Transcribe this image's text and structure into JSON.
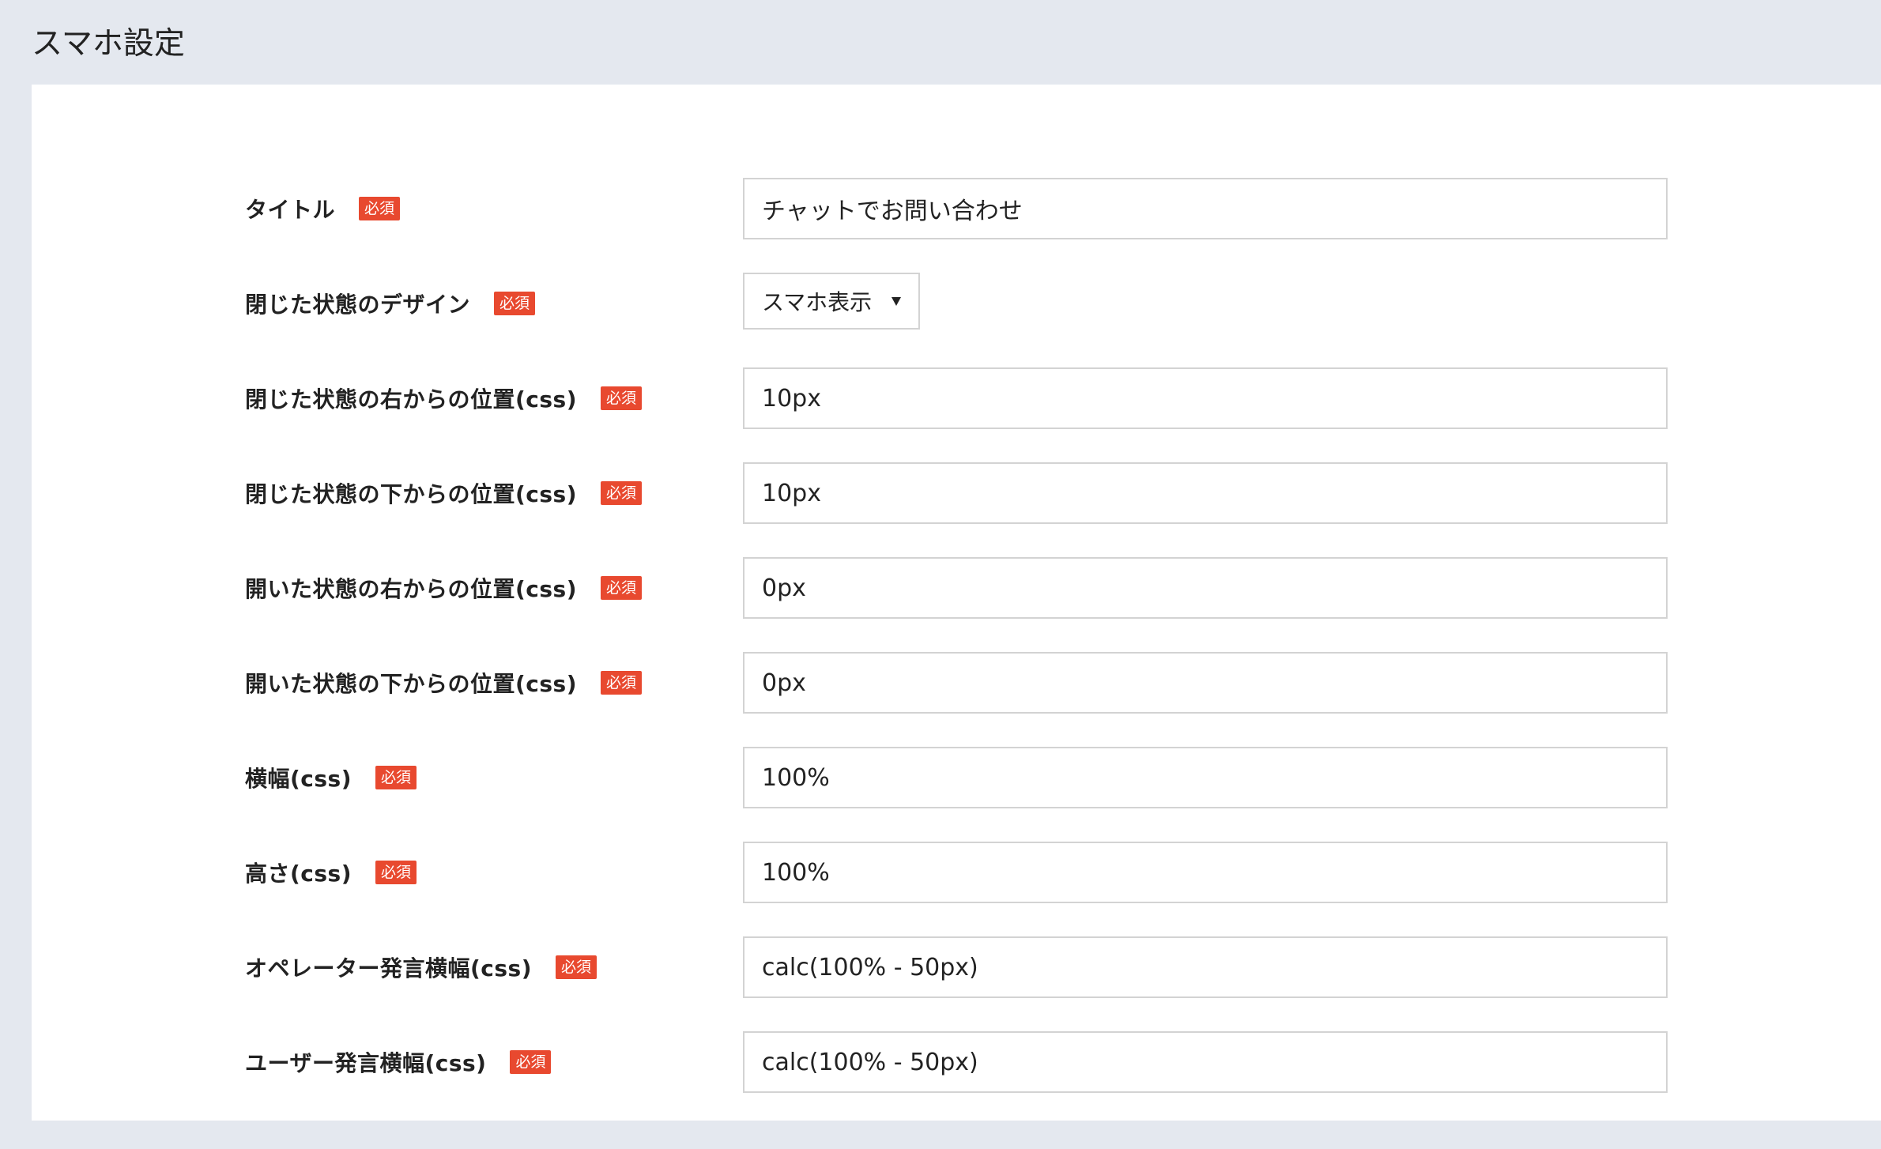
{
  "header": {
    "title": "スマホ設定"
  },
  "badge_color": "#e8492f",
  "form": {
    "fields": [
      {
        "label": "タイトル",
        "badge": "必須",
        "type": "text",
        "value": "チャットでお問い合わせ"
      },
      {
        "label": "閉じた状態のデザイン",
        "badge": "必須",
        "type": "select",
        "value": "スマホ表示"
      },
      {
        "label": "閉じた状態の右からの位置(css)",
        "badge": "必須",
        "type": "text",
        "value": "10px"
      },
      {
        "label": "閉じた状態の下からの位置(css)",
        "badge": "必須",
        "type": "text",
        "value": "10px"
      },
      {
        "label": "開いた状態の右からの位置(css)",
        "badge": "必須",
        "type": "text",
        "value": "0px"
      },
      {
        "label": "開いた状態の下からの位置(css)",
        "badge": "必須",
        "type": "text",
        "value": "0px"
      },
      {
        "label": "横幅(css)",
        "badge": "必須",
        "type": "text",
        "value": "100%"
      },
      {
        "label": "高さ(css)",
        "badge": "必須",
        "type": "text",
        "value": "100%"
      },
      {
        "label": "オペレーター発言横幅(css)",
        "badge": "必須",
        "type": "text",
        "value": "calc(100% - 50px)"
      },
      {
        "label": "ユーザー発言横幅(css)",
        "badge": "必須",
        "type": "text",
        "value": "calc(100% - 50px)"
      }
    ]
  }
}
